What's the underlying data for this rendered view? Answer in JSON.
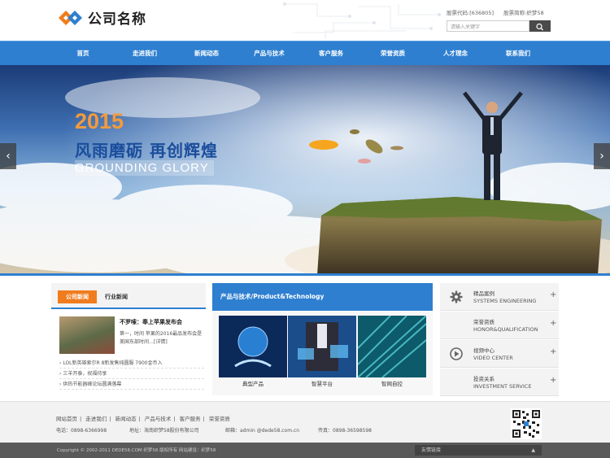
{
  "header": {
    "company_name": "公司名称",
    "stock_code": "股票代码:[636805]",
    "stock_short": "股票简称:织梦58",
    "search_placeholder": "请输入关键字"
  },
  "nav": {
    "items": [
      {
        "label": "首页"
      },
      {
        "label": "走进我们"
      },
      {
        "label": "新闻动态"
      },
      {
        "label": "产品与技术"
      },
      {
        "label": "客户服务"
      },
      {
        "label": "荣誉资质"
      },
      {
        "label": "人才理念"
      },
      {
        "label": "联系我们"
      }
    ]
  },
  "banner": {
    "year": "2015",
    "slogan_cn": "风雨磨砺 再创辉煌",
    "slogan_en": "GROUNDING GLORY",
    "prev": "‹",
    "next": "›"
  },
  "news": {
    "tab_active": "公司新闻",
    "tab_other": "行业新闻",
    "featured_title": "不罗嗦：奉上苹果发布会",
    "featured_summary": "第一，时间 苹果的2016最品发布会是美国东部时间…[详情]",
    "list": [
      "LOL新英雄索尔R 8新发售纯圆服 7900金币入",
      "三羊开泰，祝福待享",
      "供热节能器峰论坛圆满落幕"
    ]
  },
  "products": {
    "header": "产品与技术/Product&Technology",
    "items": [
      {
        "label": "典型产品"
      },
      {
        "label": "智慧平台"
      },
      {
        "label": "智网自控"
      }
    ]
  },
  "services": {
    "items": [
      {
        "cn": "精品案例",
        "en": "SYSTEMS ENGINEERING",
        "icon": "gear-icon"
      },
      {
        "cn": "荣誉资质",
        "en": "HONOR&QUALIFICATION",
        "icon": "blank-icon"
      },
      {
        "cn": "视频中心",
        "en": "VIDEO CENTER",
        "icon": "video-icon"
      },
      {
        "cn": "投资关系",
        "en": "INVESTMENT SERVICE",
        "icon": "blank-icon"
      }
    ],
    "plus": "+"
  },
  "footer": {
    "links": [
      "网站首页",
      "走进我们",
      "新闻动态",
      "产品与技术",
      "客户服务",
      "荣誉资质"
    ],
    "separator": "|",
    "phone": "电话：0898-6366998",
    "address": "地址：海南织梦58股份有限公司",
    "email": "邮箱：admin @dede58.com.cn",
    "fax": "传真：0898-36598598",
    "copyright": "Copyright © 2002-2011 DEDE58.COM 织梦58 版权所有 网站建设：织梦58",
    "friend_links": "友情链接",
    "caret": "▲"
  },
  "colors": {
    "brand_blue": "#2e7fd0",
    "accent_orange": "#f07c1e",
    "footer_dark": "#5a5a5a"
  }
}
